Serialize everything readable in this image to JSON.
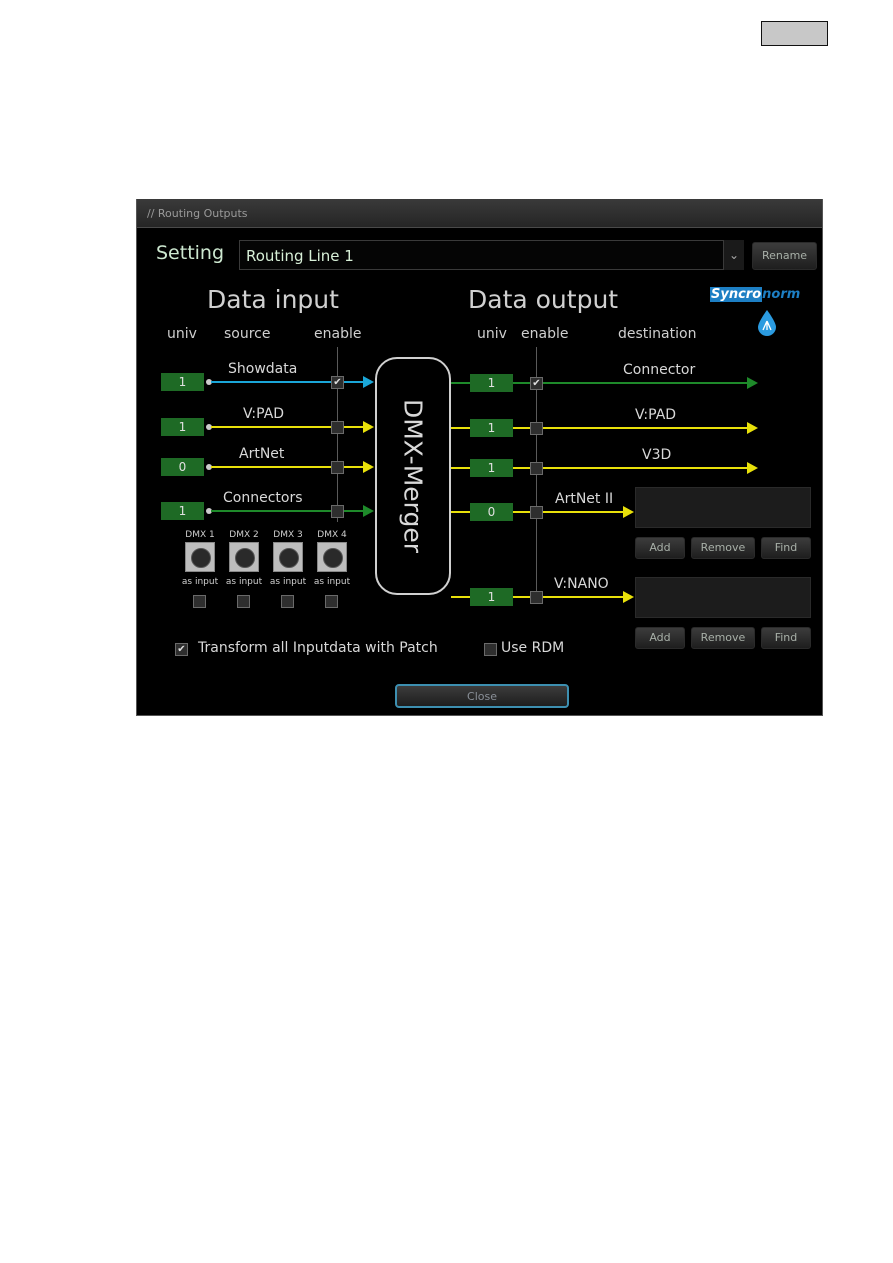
{
  "page": {
    "top_right_box": ""
  },
  "window": {
    "title": "// Routing Outputs",
    "setting_label": "Setting",
    "setting_value": "Routing Line 1",
    "rename_label": "Rename",
    "logo_part1": "Syncro",
    "logo_part2": "norm",
    "close_label": "Close"
  },
  "input": {
    "heading": "Data input",
    "col_univ": "univ",
    "col_source": "source",
    "col_enable": "enable",
    "rows": [
      {
        "univ": "1",
        "source": "Showdata",
        "enabled": true,
        "color": "#1aa6d8"
      },
      {
        "univ": "1",
        "source": "V:PAD",
        "enabled": false,
        "color": "#e8e00a"
      },
      {
        "univ": "0",
        "source": "ArtNet",
        "enabled": false,
        "color": "#e8e00a"
      },
      {
        "univ": "1",
        "source": "Connectors",
        "enabled": false,
        "color": "#1e8a2a"
      }
    ],
    "dmx_ports": [
      {
        "label": "DMX 1",
        "sub": "as input",
        "checked": false
      },
      {
        "label": "DMX 2",
        "sub": "as input",
        "checked": false
      },
      {
        "label": "DMX 3",
        "sub": "as input",
        "checked": false
      },
      {
        "label": "DMX 4",
        "sub": "as input",
        "checked": false
      }
    ]
  },
  "merger": {
    "label": "DMX-Merger"
  },
  "output": {
    "heading": "Data output",
    "col_univ": "univ",
    "col_enable": "enable",
    "col_destination": "destination",
    "rows": [
      {
        "univ": "1",
        "destination": "Connector",
        "enabled": true,
        "color": "#1e8a2a"
      },
      {
        "univ": "1",
        "destination": "V:PAD",
        "enabled": false,
        "color": "#e8e00a"
      },
      {
        "univ": "1",
        "destination": "V3D",
        "enabled": false,
        "color": "#e8e00a"
      },
      {
        "univ": "0",
        "destination": "ArtNet II",
        "enabled": false,
        "color": "#e8e00a"
      },
      {
        "univ": "1",
        "destination": "V:NANO",
        "enabled": false,
        "color": "#e8e00a"
      }
    ],
    "list_buttons": {
      "add": "Add",
      "remove": "Remove",
      "find": "Find"
    }
  },
  "options": {
    "transform_label": "Transform all Inputdata with Patch",
    "transform_checked": true,
    "rdm_label": "Use RDM",
    "rdm_checked": false
  }
}
